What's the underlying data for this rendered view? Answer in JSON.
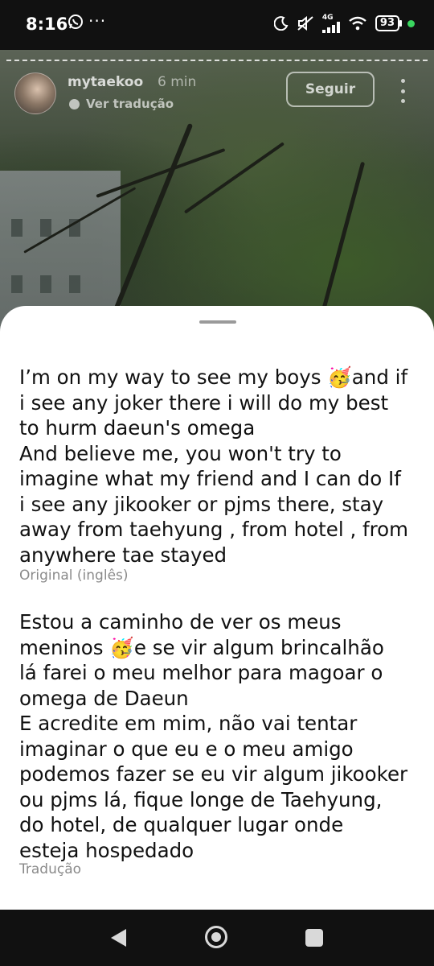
{
  "status_bar": {
    "time": "8:16",
    "battery": "93",
    "network": "4G"
  },
  "story": {
    "username": "mytaekoo",
    "time_ago": "6 min",
    "translate_link": "Ver tradução",
    "follow_label": "Seguir"
  },
  "translation_sheet": {
    "original_text": "I’m on my way to see my boys 🥳and if\ni see any joker there i will do my best\nto hurm daeun's omega\nAnd believe me, you won't try to\nimagine what my friend and I can do If\ni see any jikooker or pjms there, stay\naway from taehyung , from hotel , from\nanywhere tae stayed",
    "original_label": "Original (inglês)",
    "translated_text": "Estou a caminho de ver os meus\nmeninos 🥳e se vir algum brincalhão\nlá farei o meu melhor para magoar o\nomega de Daeun\nE acredite em mim, não vai tentar\nimaginar o que eu e o meu amigo\npodemos fazer se eu vir algum jikooker\nou pjms lá, fique longe de Taehyung,\ndo hotel, de qualquer lugar onde\nesteja hospedado",
    "translated_label": "Tradução"
  },
  "colors": {
    "sheet_background": "#ffffff",
    "text": "#111111",
    "label": "#8a8a8a",
    "status_accent": "#3ad65f"
  },
  "icons": [
    "whatsapp-icon",
    "moon-icon",
    "mute-icon",
    "signal-icon",
    "wifi-icon",
    "battery-icon",
    "more-vertical-icon",
    "back-icon",
    "home-icon",
    "recents-icon"
  ]
}
